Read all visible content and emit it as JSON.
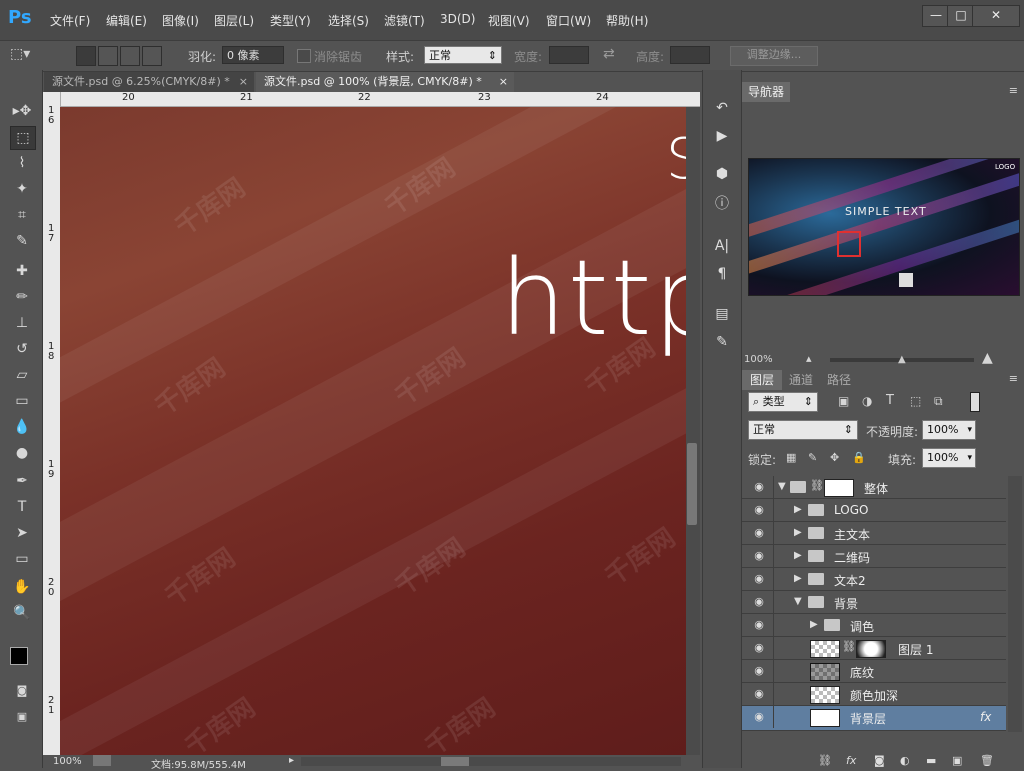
{
  "app": {
    "logo": "Ps"
  },
  "menu": [
    "文件(F)",
    "编辑(E)",
    "图像(I)",
    "图层(L)",
    "类型(Y)",
    "选择(S)",
    "滤镜(T)",
    "3D(D)",
    "视图(V)",
    "窗口(W)",
    "帮助(H)"
  ],
  "options": {
    "feather_label": "羽化:",
    "feather_value": "0 像素",
    "antialias_label": "消除锯齿",
    "style_label": "样式:",
    "style_value": "正常",
    "width_label": "宽度:",
    "height_label": "高度:",
    "refine_edge": "调整边缘..."
  },
  "tabs": [
    {
      "label": "源文件.psd @ 6.25%(CMYK/8#) *",
      "active": false
    },
    {
      "label": "源文件.psd @ 100% (背景层, CMYK/8#) *",
      "active": true
    }
  ],
  "ruler": {
    "top": [
      "20",
      "21",
      "22",
      "23",
      "24"
    ],
    "left": [
      "1\n6",
      "1\n7",
      "1\n8",
      "1\n9",
      "2\n0",
      "2\n1"
    ]
  },
  "canvas": {
    "text": "http",
    "partial_glyph": "S"
  },
  "watermark": "千库网",
  "status": {
    "zoom": "100%",
    "doc": "文档:95.8M/555.4M"
  },
  "navigator": {
    "title": "导航器",
    "zoom": "100%",
    "thumb_title": "SIMPLE TEXT",
    "thumb_logo": "LOGO"
  },
  "layers": {
    "tabs": [
      "图层",
      "通道",
      "路径"
    ],
    "filter_label": "类型",
    "blend_mode": "正常",
    "opacity_label": "不透明度:",
    "opacity_value": "100%",
    "lock_label": "锁定:",
    "fill_label": "填充:",
    "fill_value": "100%",
    "items": [
      {
        "name": "整体",
        "type": "group",
        "indent": 0,
        "expanded": true,
        "has_mask": true
      },
      {
        "name": "LOGO",
        "type": "group",
        "indent": 1,
        "expanded": false
      },
      {
        "name": "主文本",
        "type": "group",
        "indent": 1,
        "expanded": false
      },
      {
        "name": "二维码",
        "type": "group",
        "indent": 1,
        "expanded": false
      },
      {
        "name": "文本2",
        "type": "group",
        "indent": 1,
        "expanded": false
      },
      {
        "name": "背景",
        "type": "group",
        "indent": 1,
        "expanded": true
      },
      {
        "name": "调色",
        "type": "group",
        "indent": 2,
        "expanded": false
      },
      {
        "name": "图层 1",
        "type": "layer",
        "indent": 2,
        "thumb": "checker",
        "has_mask": true
      },
      {
        "name": "底纹",
        "type": "layer",
        "indent": 2,
        "thumb": "checker-dark"
      },
      {
        "name": "颜色加深",
        "type": "layer",
        "indent": 2,
        "thumb": "checker"
      },
      {
        "name": "背景层",
        "type": "layer",
        "indent": 2,
        "thumb": "white",
        "selected": true,
        "fx": "fx"
      }
    ]
  },
  "colors": {
    "accent_blue": "#31a8ff",
    "selection": "#5f7ea0",
    "nav_red": "#e03030"
  }
}
